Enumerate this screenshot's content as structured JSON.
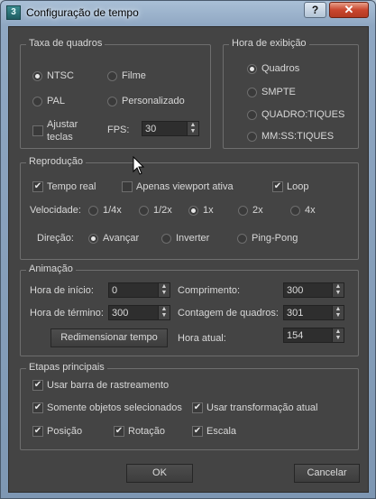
{
  "window": {
    "title": "Configuração de tempo",
    "help_label": "?",
    "close_label": "✕",
    "icon_label": "3"
  },
  "frame_rate": {
    "label": "Taxa de quadros",
    "options": [
      "NTSC",
      "Filme",
      "PAL",
      "Personalizado"
    ],
    "selected": "NTSC",
    "adjust_keys_label": "Ajustar teclas",
    "fps_label": "FPS:",
    "fps_value": "30"
  },
  "time_display": {
    "label": "Hora de exibição",
    "options": [
      "Quadros",
      "SMPTE",
      "QUADRO:TIQUES",
      "MM:SS:TIQUES"
    ],
    "selected": "Quadros"
  },
  "playback": {
    "label": "Reprodução",
    "real_time_label": "Tempo real",
    "active_viewport_label": "Apenas viewport ativa",
    "loop_label": "Loop",
    "speed_label": "Velocidade:",
    "speeds": [
      "1/4x",
      "1/2x",
      "1x",
      "2x",
      "4x"
    ],
    "selected_speed": "1x",
    "direction_label": "Direção:",
    "directions": [
      "Avançar",
      "Inverter",
      "Ping-Pong"
    ],
    "selected_direction": "Avançar"
  },
  "animation": {
    "label": "Animação",
    "start_time_label": "Hora de início:",
    "start_time": "0",
    "end_time_label": "Hora de término:",
    "end_time": "300",
    "length_label": "Comprimento:",
    "length": "300",
    "frame_count_label": "Contagem de quadros:",
    "frame_count": "301",
    "rescale_label": "Redimensionar tempo",
    "current_time_label": "Hora atual:",
    "current_time": "154"
  },
  "key_steps": {
    "label": "Etapas principais",
    "use_trackbar_label": "Usar barra de rastreamento",
    "selected_only_label": "Somente objetos selecionados",
    "use_current_transform_label": "Usar transformação atual",
    "position_label": "Posição",
    "rotation_label": "Rotação",
    "scale_label": "Escala"
  },
  "footer": {
    "ok_label": "OK",
    "cancel_label": "Cancelar"
  }
}
